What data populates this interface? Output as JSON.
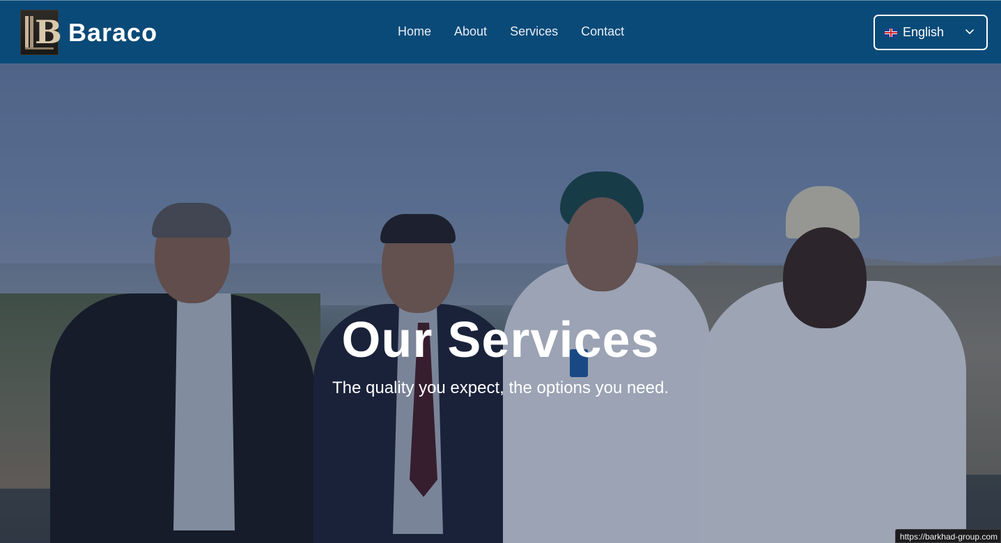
{
  "header": {
    "brand": "Baraco",
    "logo_icon": "baraco-logo",
    "nav": [
      {
        "label": "Home"
      },
      {
        "label": "About"
      },
      {
        "label": "Services"
      },
      {
        "label": "Contact"
      }
    ],
    "language": {
      "selected": "English",
      "flag_icon": "uk-flag-icon",
      "chevron_icon": "chevron-down-icon"
    },
    "colors": {
      "bar": "#0a4a78",
      "text": "#ffffff"
    }
  },
  "hero": {
    "title": "Our Services",
    "subtitle": "The quality you expect, the options you need.",
    "image": "photo of four men standing on a balcony overlooking a port"
  },
  "status_bar": {
    "url": "https://barkhad-group.com"
  }
}
